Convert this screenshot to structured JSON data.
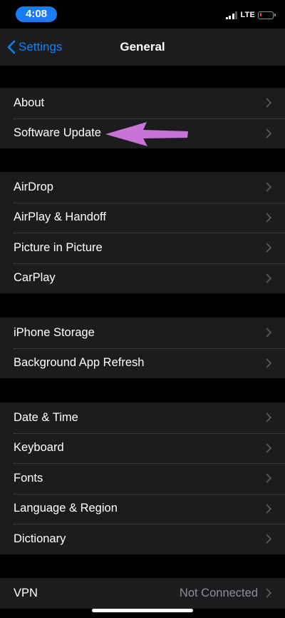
{
  "status": {
    "time": "4:08",
    "network": "LTE",
    "signal_bars_active": 3,
    "signal_bars_total": 4,
    "battery_level": 0.12,
    "time_pill_color": "#1a7cf5",
    "battery_color": "#ff3b30"
  },
  "nav": {
    "back_label": "Settings",
    "back_icon": "chevron-left-icon",
    "title": "General"
  },
  "groups": [
    {
      "rows": [
        {
          "label": "About"
        },
        {
          "label": "Software Update"
        }
      ]
    },
    {
      "rows": [
        {
          "label": "AirDrop"
        },
        {
          "label": "AirPlay & Handoff"
        },
        {
          "label": "Picture in Picture"
        },
        {
          "label": "CarPlay"
        }
      ]
    },
    {
      "rows": [
        {
          "label": "iPhone Storage"
        },
        {
          "label": "Background App Refresh"
        }
      ]
    },
    {
      "rows": [
        {
          "label": "Date & Time"
        },
        {
          "label": "Keyboard"
        },
        {
          "label": "Fonts"
        },
        {
          "label": "Language & Region"
        },
        {
          "label": "Dictionary"
        }
      ]
    },
    {
      "rows": [
        {
          "label": "VPN",
          "detail": "Not Connected"
        }
      ]
    }
  ],
  "annotation": {
    "icon": "arrow-left-icon",
    "color": "#c774d6",
    "points_to": "Software Update"
  },
  "colors": {
    "accent": "#0a84ff",
    "background": "#000000",
    "cell": "#1c1c1e",
    "separator": "#38383a",
    "secondary_text": "#8e8e93"
  }
}
